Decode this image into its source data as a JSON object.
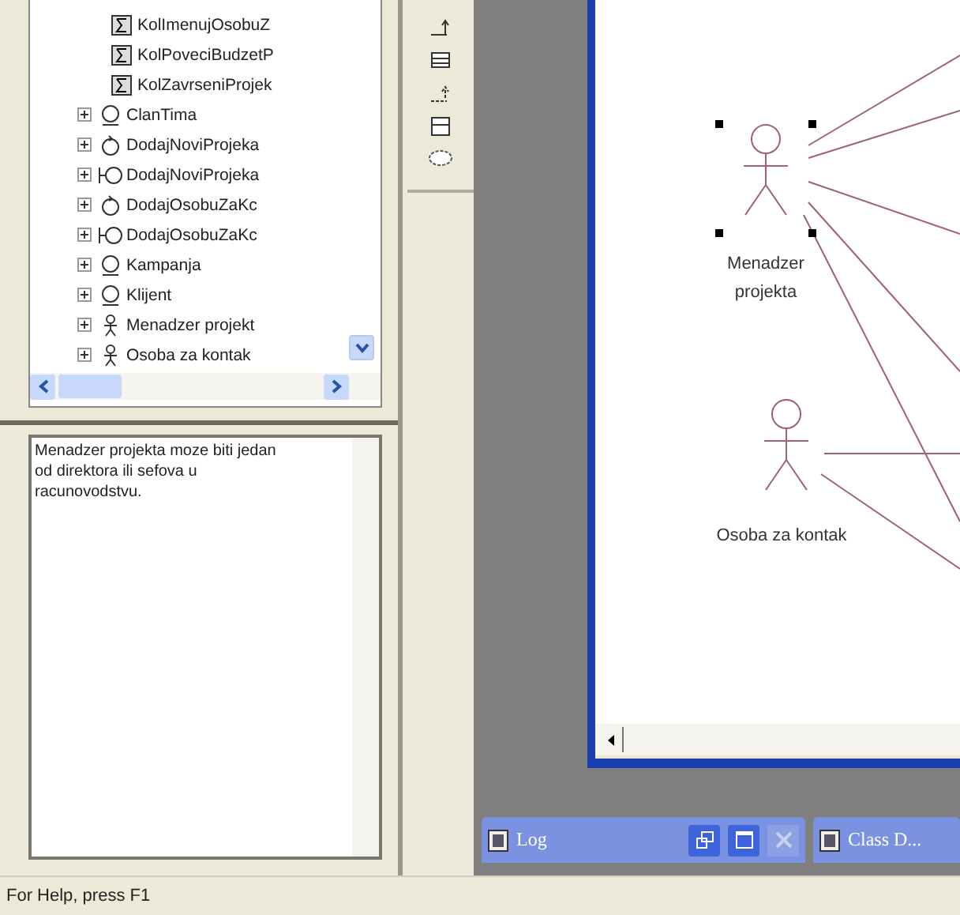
{
  "browser": {
    "items": [
      {
        "label": "KolImenujOsobuZ",
        "kind": "collaboration",
        "expandable": false
      },
      {
        "label": "KolPoveciBudzetP",
        "kind": "collaboration",
        "expandable": false
      },
      {
        "label": "KolZavrseniProjek",
        "kind": "collaboration",
        "expandable": false
      },
      {
        "label": "ClanTima",
        "kind": "entity",
        "expandable": true
      },
      {
        "label": "DodajNoviProjeka",
        "kind": "control",
        "expandable": true
      },
      {
        "label": "DodajNoviProjeka",
        "kind": "boundary",
        "expandable": true
      },
      {
        "label": "DodajOsobuZaKc",
        "kind": "control",
        "expandable": true
      },
      {
        "label": "DodajOsobuZaKc",
        "kind": "boundary",
        "expandable": true
      },
      {
        "label": "Kampanja",
        "kind": "entity",
        "expandable": true
      },
      {
        "label": "Klijent",
        "kind": "entity",
        "expandable": true
      },
      {
        "label": "Menadzer projekt",
        "kind": "actor",
        "expandable": true
      },
      {
        "label": "Osoba za kontak",
        "kind": "actor",
        "expandable": true
      }
    ]
  },
  "documentation": {
    "text": "Menadzer projekta moze biti jedan od direktora ili sefova u racunovodstvu."
  },
  "diagram": {
    "actors": [
      {
        "label": "Menadzer projekta",
        "selected": true
      },
      {
        "label": "Osoba za kontak",
        "selected": false
      }
    ]
  },
  "minimized_windows": [
    {
      "title": "Log"
    },
    {
      "title": "Class D..."
    }
  ],
  "status_bar": {
    "text": "For Help, press F1"
  }
}
